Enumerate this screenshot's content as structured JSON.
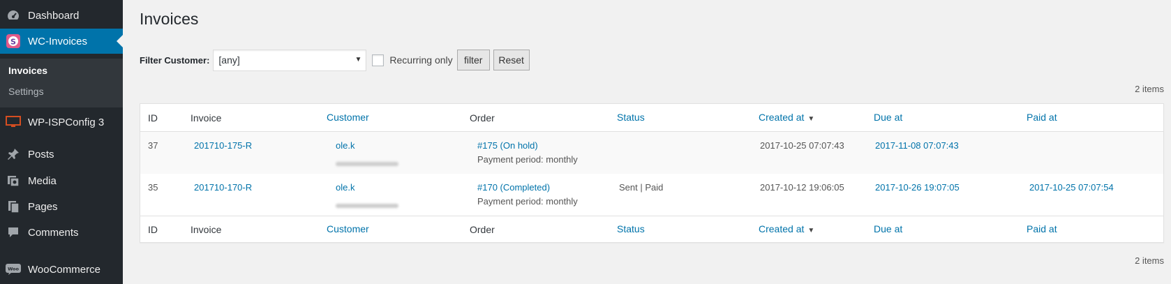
{
  "sidebar": {
    "items": [
      {
        "label": "Dashboard",
        "icon": "dashboard-icon"
      },
      {
        "label": "WC-Invoices",
        "icon": "invoice-icon"
      },
      {
        "label": "WP-ISPConfig 3",
        "icon": "monitor-icon"
      },
      {
        "label": "Posts",
        "icon": "pin-icon"
      },
      {
        "label": "Media",
        "icon": "media-icon"
      },
      {
        "label": "Pages",
        "icon": "pages-icon"
      },
      {
        "label": "Comments",
        "icon": "comment-icon"
      },
      {
        "label": "WooCommerce",
        "icon": "woo-icon"
      }
    ],
    "submenu": [
      {
        "label": "Invoices"
      },
      {
        "label": "Settings"
      }
    ]
  },
  "page": {
    "title": "Invoices"
  },
  "filter": {
    "label": "Filter Customer:",
    "select_value": "[any]",
    "recurring_label": "Recurring only",
    "filter_button": "filter",
    "reset_button": "Reset"
  },
  "items_count": "2 items",
  "table": {
    "headers": {
      "id": "ID",
      "invoice": "Invoice",
      "customer": "Customer",
      "order": "Order",
      "status": "Status",
      "created": "Created at",
      "due": "Due at",
      "paid": "Paid at"
    },
    "rows": [
      {
        "id": "37",
        "invoice": "201710-175-R",
        "customer": "ole.k",
        "order": "#175 (On hold)",
        "period": "Payment period: monthly",
        "status": "",
        "created": "2017-10-25 07:07:43",
        "due": "2017-11-08 07:07:43",
        "paid": ""
      },
      {
        "id": "35",
        "invoice": "201710-170-R",
        "customer": "ole.k",
        "order": "#170 (Completed)",
        "period": "Payment period: monthly",
        "status": "Sent | Paid",
        "created": "2017-10-12 19:06:05",
        "due": "2017-10-26 19:07:05",
        "paid": "2017-10-25 07:07:54"
      }
    ]
  },
  "colors": {
    "accent": "#0073aa",
    "sidebar_bg": "#23282d",
    "submenu_bg": "#32373c"
  }
}
